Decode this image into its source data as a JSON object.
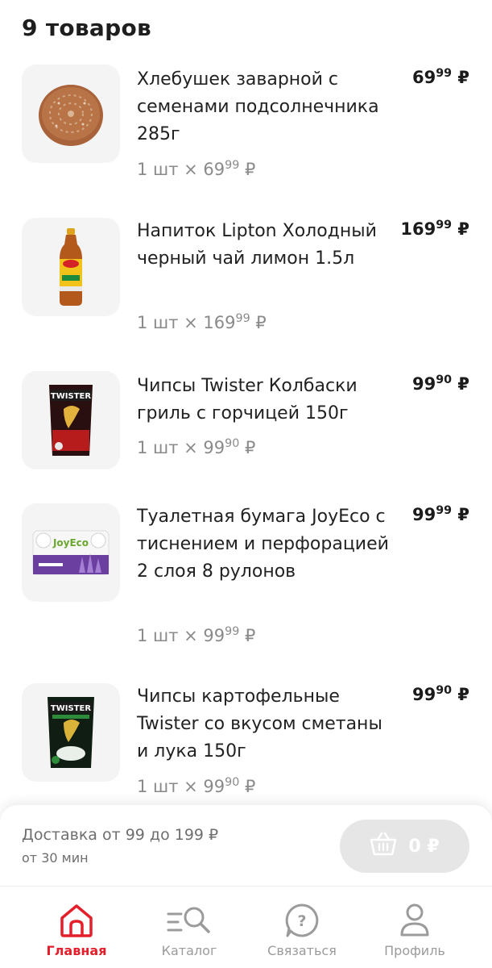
{
  "header": {
    "title": "9 товаров"
  },
  "items": [
    {
      "name": "Хлебушек заварной с семенами подсолнечника 285г",
      "price_int": "69",
      "price_frac": "99",
      "currency": "₽",
      "qty_text": "1 шт × 69",
      "qty_frac": "99",
      "image": "bread-image"
    },
    {
      "name": "Напиток Lipton Холодный черный чай лимон 1.5л",
      "price_int": "169",
      "price_frac": "99",
      "currency": "₽",
      "qty_text": "1 шт × 169",
      "qty_frac": "99",
      "image": "lipton-bottle-image"
    },
    {
      "name": "Чипсы Twister Колбаски гриль с горчицей 150г",
      "price_int": "99",
      "price_frac": "90",
      "currency": "₽",
      "qty_text": "1 шт × 99",
      "qty_frac": "90",
      "image": "twister-red-chips-image"
    },
    {
      "name": "Туалетная бумага JoyEco с тиснением и перфорацией 2 слоя 8 рулонов",
      "price_int": "99",
      "price_frac": "99",
      "currency": "₽",
      "qty_text": "1 шт × 99",
      "qty_frac": "99",
      "image": "toilet-paper-image"
    },
    {
      "name": "Чипсы картофельные Twister со вкусом сметаны и лука 150г",
      "price_int": "99",
      "price_frac": "90",
      "currency": "₽",
      "qty_text": "1 шт × 99",
      "qty_frac": "90",
      "image": "twister-green-chips-image"
    }
  ],
  "delivery": {
    "line1": "Доставка от 99 до 199 ₽",
    "line2": "от 30 мин"
  },
  "cart": {
    "amount": "0 ₽",
    "icon": "basket-icon"
  },
  "tabs": [
    {
      "label": "Главная",
      "icon": "home-icon",
      "active": true
    },
    {
      "label": "Каталог",
      "icon": "catalog-search-icon",
      "active": false
    },
    {
      "label": "Связаться",
      "icon": "help-chat-icon",
      "active": false
    },
    {
      "label": "Профиль",
      "icon": "user-icon",
      "active": false
    }
  ],
  "colors": {
    "accent": "#e31f2b",
    "muted": "#8a8a8a",
    "thumb_bg": "#f4f4f4",
    "cart_btn": "#e6e6e6"
  }
}
